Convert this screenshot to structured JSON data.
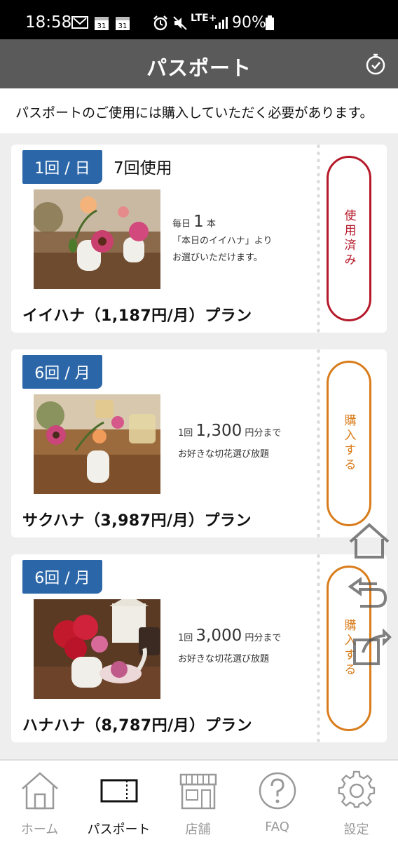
{
  "status_bar": {
    "time": "18:58",
    "calendar_day_1": "31",
    "calendar_day_2": "31",
    "network": "LTE+",
    "battery": "90%"
  },
  "header": {
    "title": "パスポート",
    "right_icon": "timer-icon"
  },
  "notice": "パスポートのご使用には購入していただく必要があります。",
  "plans": [
    {
      "frequency": "1回 / 日",
      "usage": "7回使用",
      "desc_line1_prefix": "毎日",
      "desc_line1_value": "1",
      "desc_line1_suffix": "本",
      "desc_line2": "「本日のイイハナ」より",
      "desc_line3": "お選びいただけます。",
      "name": "イイハナ（1,187円/月）プラン",
      "action": "使用済み",
      "action_state": "used"
    },
    {
      "frequency": "6回 / 月",
      "usage": "",
      "desc_line1_prefix": "1回",
      "desc_line1_value": "1,300",
      "desc_line1_suffix": "円分まで",
      "desc_line2": "お好きな切花選び放題",
      "desc_line3": "",
      "name": "サクハナ（3,987円/月）プラン",
      "action": "購入する",
      "action_state": "buy"
    },
    {
      "frequency": "6回 / 月",
      "usage": "",
      "desc_line1_prefix": "1回",
      "desc_line1_value": "3,000",
      "desc_line1_suffix": "円分まで",
      "desc_line2": "お好きな切花選び放題",
      "desc_line3": "",
      "name": "ハナハナ（8,787円/月）プラン",
      "action": "購入する",
      "action_state": "buy"
    }
  ],
  "floating_buttons": [
    "home-icon",
    "back-icon",
    "share-icon"
  ],
  "bottom_nav": [
    {
      "label": "ホーム",
      "icon": "home-icon",
      "active": false
    },
    {
      "label": "パスポート",
      "icon": "ticket-icon",
      "active": true
    },
    {
      "label": "店舗",
      "icon": "store-icon",
      "active": false
    },
    {
      "label": "FAQ",
      "icon": "question-icon",
      "active": false
    },
    {
      "label": "設定",
      "icon": "gear-icon",
      "active": false
    }
  ],
  "colors": {
    "header_bg": "#5a5a5a",
    "badge_blue": "#2b66a8",
    "used_red": "#b5192a",
    "buy_orange": "#d97c1b"
  }
}
